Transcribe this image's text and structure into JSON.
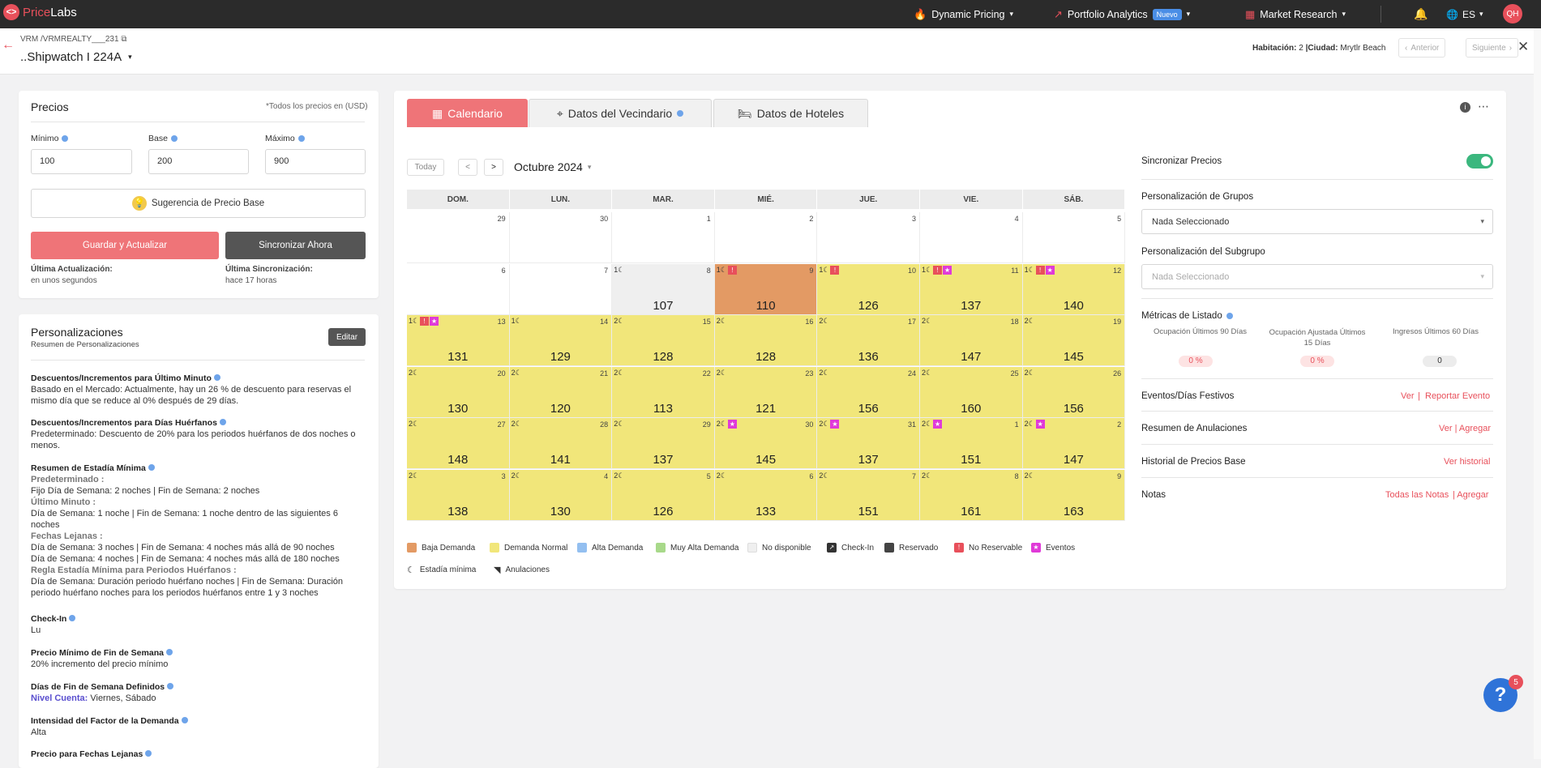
{
  "topbar": {
    "brand_price": "Price",
    "brand_labs": "Labs",
    "nav": [
      {
        "label": "Dynamic Pricing",
        "icon": "flame-icon"
      },
      {
        "label": "Portfolio Analytics",
        "icon": "trend-icon",
        "badge": "Nuevo"
      },
      {
        "label": "Market Research",
        "icon": "grid-icon"
      }
    ],
    "lang": "ES",
    "avatar": "QH"
  },
  "header": {
    "breadcrumb": "VRM /VRMREALTY___231",
    "listing": "..Shipwatch I 224A",
    "room_label": "Habitación:",
    "room_value": "2",
    "city_label": "|Ciudad:",
    "city_value": "Mrytlr Beach",
    "prev": "Anterior",
    "next": "Siguiente"
  },
  "prices": {
    "title": "Precios",
    "currency_note": "*Todos los precios en (USD)",
    "min_label": "Mínimo",
    "min_value": "100",
    "base_label": "Base",
    "base_value": "200",
    "max_label": "Máximo",
    "max_value": "900",
    "suggest": "Sugerencia de Precio Base",
    "save": "Guardar y Actualizar",
    "sync": "Sincronizar Ahora",
    "last_update_label": "Última Actualización:",
    "last_update_value": "en unos segundos",
    "last_sync_label": "Última Sincronización:",
    "last_sync_value": "hace 17 horas"
  },
  "customizations": {
    "title": "Personalizaciones",
    "subtitle": "Resumen de Personalizaciones",
    "edit": "Editar",
    "lastmin_title": "Descuentos/Incrementos para Último Minuto",
    "lastmin_text": "Basado en el Mercado: Actualmente, hay un 26 % de descuento para reservas el mismo día que se reduce al 0% después de 29 días.",
    "orphan_title": "Descuentos/Incrementos para Días Huérfanos",
    "orphan_text": "Predeterminado: Descuento de 20% para los periodos huérfanos de dos noches o menos.",
    "minstay_title": "Resumen de Estadía Mínima",
    "minstay_default_label": "Predeterminado :",
    "minstay_default_text": "Fijo Día de Semana: 2 noches | Fin de Semana: 2 noches",
    "minstay_lastmin_label": "Último Minuto :",
    "minstay_lastmin_text": "Día de Semana: 1 noche | Fin de Semana: 1 noche dentro de las siguientes 6 noches",
    "minstay_far_label": "Fechas Lejanas :",
    "minstay_far_text1": "Día de Semana: 3 noches | Fin de Semana: 4 noches más allá de 90 noches",
    "minstay_far_text2": "Día de Semana: 4 noches | Fin de Semana: 4 noches más allá de 180 noches",
    "minstay_orphan_label": "Regla Estadía Mínima para Periodos Huérfanos :",
    "minstay_orphan_text": "Día de Semana: Duración periodo huérfano noches | Fin de Semana: Duración periodo huérfano noches para los periodos huérfanos entre 1 y 3 noches",
    "checkin_title": "Check-In",
    "checkin_text": "Lu",
    "weekend_min_title": "Precio Mínimo de Fin de Semana",
    "weekend_min_text": "20% incremento del precio mínimo",
    "weekend_days_title": "Días de Fin de Semana Definidos",
    "weekend_days_level": "Nivel Cuenta:",
    "weekend_days_text": "Viernes, Sábado",
    "demand_title": "Intensidad del Factor de la Demanda",
    "demand_text": "Alta",
    "far_title": "Precio para Fechas Lejanas"
  },
  "tabs": [
    "Calendario",
    "Datos del Vecindario",
    "Datos de Hoteles"
  ],
  "calendar": {
    "today": "Today",
    "prev": "<",
    "next": ">",
    "month": "Octubre 2024",
    "weekdays": [
      "DOM.",
      "LUN.",
      "MAR.",
      "MIÉ.",
      "JUE.",
      "VIE.",
      "SÁB."
    ],
    "weeks": [
      [
        {
          "d": "29",
          "p": "",
          "c": "white"
        },
        {
          "d": "30",
          "p": "",
          "c": "white"
        },
        {
          "d": "1",
          "p": "",
          "c": "white"
        },
        {
          "d": "2",
          "p": "",
          "c": "white"
        },
        {
          "d": "3",
          "p": "",
          "c": "white"
        },
        {
          "d": "4",
          "p": "",
          "c": "white"
        },
        {
          "d": "5",
          "p": "",
          "c": "white"
        }
      ],
      [
        {
          "d": "6",
          "p": "",
          "c": "white"
        },
        {
          "d": "7",
          "p": "",
          "c": "white"
        },
        {
          "d": "8",
          "p": "107",
          "c": "gray",
          "m": "1☾"
        },
        {
          "d": "9",
          "p": "110",
          "c": "orange",
          "m": "1☾",
          "w": true
        },
        {
          "d": "10",
          "p": "126",
          "c": "yellow",
          "m": "1☾",
          "w": true
        },
        {
          "d": "11",
          "p": "137",
          "c": "yellow",
          "m": "1☾",
          "w": true,
          "s": true
        },
        {
          "d": "12",
          "p": "140",
          "c": "yellow",
          "m": "1☾",
          "w": true,
          "s": true
        }
      ],
      [
        {
          "d": "13",
          "p": "131",
          "c": "yellow",
          "m": "1☾",
          "w": true,
          "s": true
        },
        {
          "d": "14",
          "p": "129",
          "c": "yellow",
          "m": "1☾"
        },
        {
          "d": "15",
          "p": "128",
          "c": "yellow",
          "m": "2☾"
        },
        {
          "d": "16",
          "p": "128",
          "c": "yellow",
          "m": "2☾"
        },
        {
          "d": "17",
          "p": "136",
          "c": "yellow",
          "m": "2☾"
        },
        {
          "d": "18",
          "p": "147",
          "c": "yellow",
          "m": "2☾"
        },
        {
          "d": "19",
          "p": "145",
          "c": "yellow",
          "m": "2☾"
        }
      ],
      [
        {
          "d": "20",
          "p": "130",
          "c": "yellow",
          "m": "2☾"
        },
        {
          "d": "21",
          "p": "120",
          "c": "yellow",
          "m": "2☾"
        },
        {
          "d": "22",
          "p": "113",
          "c": "yellow",
          "m": "2☾"
        },
        {
          "d": "23",
          "p": "121",
          "c": "yellow",
          "m": "2☾"
        },
        {
          "d": "24",
          "p": "156",
          "c": "yellow",
          "m": "2☾"
        },
        {
          "d": "25",
          "p": "160",
          "c": "yellow",
          "m": "2☾"
        },
        {
          "d": "26",
          "p": "156",
          "c": "yellow",
          "m": "2☾"
        }
      ],
      [
        {
          "d": "27",
          "p": "148",
          "c": "yellow",
          "m": "2☾"
        },
        {
          "d": "28",
          "p": "141",
          "c": "yellow",
          "m": "2☾"
        },
        {
          "d": "29",
          "p": "137",
          "c": "yellow",
          "m": "2☾"
        },
        {
          "d": "30",
          "p": "145",
          "c": "yellow",
          "m": "2☾",
          "s": true
        },
        {
          "d": "31",
          "p": "137",
          "c": "yellow",
          "m": "2☾",
          "s": true
        },
        {
          "d": "1",
          "p": "151",
          "c": "yellow",
          "m": "2☾",
          "s": true
        },
        {
          "d": "2",
          "p": "147",
          "c": "yellow",
          "m": "2☾",
          "s": true
        }
      ],
      [
        {
          "d": "3",
          "p": "138",
          "c": "yellow",
          "m": "2☾"
        },
        {
          "d": "4",
          "p": "130",
          "c": "yellow",
          "m": "2☾"
        },
        {
          "d": "5",
          "p": "126",
          "c": "yellow",
          "m": "2☾"
        },
        {
          "d": "6",
          "p": "133",
          "c": "yellow",
          "m": "2☾"
        },
        {
          "d": "7",
          "p": "151",
          "c": "yellow",
          "m": "2☾"
        },
        {
          "d": "8",
          "p": "161",
          "c": "yellow",
          "m": "2☾"
        },
        {
          "d": "9",
          "p": "163",
          "c": "yellow",
          "m": "2☾"
        }
      ]
    ],
    "legend": [
      {
        "label": "Baja Demanda",
        "color": "#e39a64"
      },
      {
        "label": "Demanda Normal",
        "color": "#f1e67a"
      },
      {
        "label": "Alta Demanda",
        "color": "#93bff0"
      },
      {
        "label": "Muy Alta Demanda",
        "color": "#a8d98a"
      },
      {
        "label": "No disponible",
        "color": "#efefef"
      },
      {
        "label": "Check-In",
        "color": "#333333"
      },
      {
        "label": "Reservado",
        "color": "#444444"
      },
      {
        "label": "No Reservable",
        "color": "#e8505b"
      },
      {
        "label": "Eventos",
        "color": "#e03ad8"
      }
    ],
    "legend2": [
      "Estadía mínima",
      "Anulaciones"
    ]
  },
  "right": {
    "sync_prices": "Sincronizar Precios",
    "group_title": "Personalización de Grupos",
    "group_value": "Nada Seleccionado",
    "subgroup_title": "Personalización del Subgrupo",
    "subgroup_value": "Nada Seleccionado",
    "metrics_title": "Métricas de Listado",
    "metrics": [
      {
        "label": "Ocupación Últimos 90 Días",
        "value": "0 %"
      },
      {
        "label": "Ocupación Ajustada Últimos 15 Días",
        "value": "0 %"
      },
      {
        "label": "Ingresos Últimos 60 Días",
        "value": "0"
      }
    ],
    "events_title": "Eventos/Días Festivos",
    "events_link1": "Ver",
    "events_link2": "Reportar Evento",
    "cancel_title": "Resumen de Anulaciones",
    "cancel_link": "Ver | Agregar",
    "history_title": "Historial de Precios Base",
    "history_link": "Ver historial",
    "notes_title": "Notas",
    "notes_link1": "Todas las Notas",
    "notes_link2": "| Agregar"
  },
  "help_count": "5",
  "colors": {
    "accent": "#e8505b",
    "yellow": "#f1e67a",
    "orange": "#e39a64",
    "toggle": "#3bb77e"
  }
}
